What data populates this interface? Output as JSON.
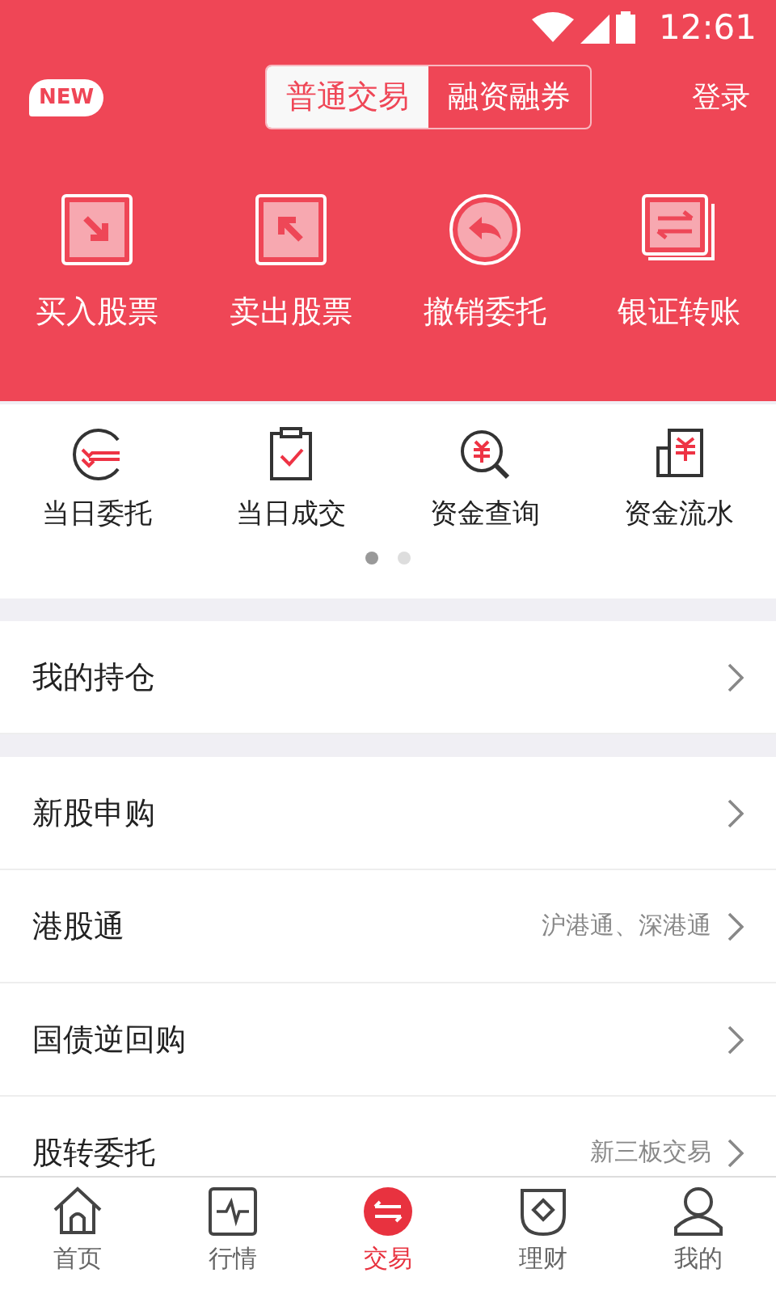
{
  "status_bar": {
    "time": "12:61"
  },
  "header": {
    "badge": "NEW",
    "login": "登录",
    "modes": [
      {
        "label": "普通交易",
        "selected": true
      },
      {
        "label": "融资融券",
        "selected": false
      }
    ]
  },
  "actions": [
    {
      "label": "买入股票",
      "kind": "buy"
    },
    {
      "label": "卖出股票",
      "kind": "sell"
    },
    {
      "label": "撤销委托",
      "kind": "cancel"
    },
    {
      "label": "银证转账",
      "kind": "transfer"
    }
  ],
  "quick": [
    {
      "label": "当日委托",
      "kind": "orders"
    },
    {
      "label": "当日成交",
      "kind": "deals"
    },
    {
      "label": "资金查询",
      "kind": "query"
    },
    {
      "label": "资金流水",
      "kind": "flow"
    }
  ],
  "pager": [
    {
      "selected": true
    },
    {
      "selected": false
    }
  ],
  "sections": [
    [
      {
        "label": "我的持仓"
      }
    ],
    [
      {
        "label": "新股申购"
      },
      {
        "label": "港股通",
        "note": "沪港通、深港通"
      },
      {
        "label": "国债逆回购"
      },
      {
        "label": "股转委托",
        "note": "新三板交易"
      }
    ]
  ],
  "nav": [
    {
      "label": "首页",
      "kind": "home",
      "selected": false
    },
    {
      "label": "行情",
      "kind": "market",
      "selected": false
    },
    {
      "label": "交易",
      "kind": "trade",
      "selected": true
    },
    {
      "label": "理财",
      "kind": "wealth",
      "selected": false
    },
    {
      "label": "我的",
      "kind": "me",
      "selected": false
    }
  ]
}
